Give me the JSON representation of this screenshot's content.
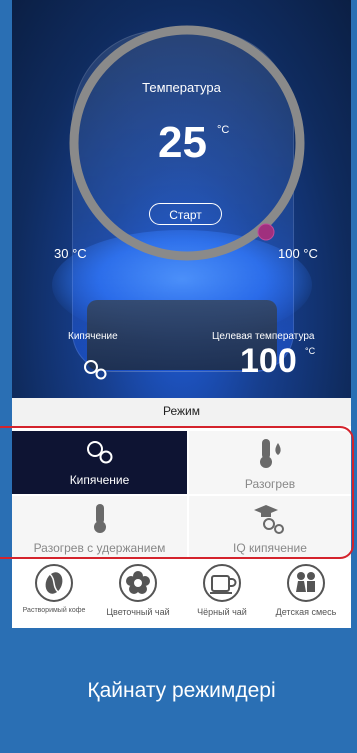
{
  "thermostat": {
    "title": "Температура",
    "current_value": "25",
    "unit": "°C",
    "start_label": "Старт",
    "min_label": "30 °C",
    "max_label": "100 °C",
    "boil_label": "Кипячение",
    "target_label": "Целевая температура",
    "target_value": "100",
    "target_unit": "°C"
  },
  "modes": {
    "title": "Режим",
    "items": [
      {
        "label": "Кипячение",
        "icon": "bubbles-icon",
        "active": true
      },
      {
        "label": "Разогрев",
        "icon": "thermometer-flame-icon",
        "active": false
      },
      {
        "label": "Разогрев с удержанием",
        "icon": "thermometer-icon",
        "active": false
      },
      {
        "label": "IQ кипячение",
        "icon": "graduation-bubbles-icon",
        "active": false
      }
    ]
  },
  "drinks": [
    {
      "label": "Растворимый кофе",
      "icon": "coffee-bean-icon"
    },
    {
      "label": "Цветочный чай",
      "icon": "flower-icon"
    },
    {
      "label": "Чёрный чай",
      "icon": "cup-icon"
    },
    {
      "label": "Детская смесь",
      "icon": "children-icon"
    }
  ],
  "caption": "Қайнату режимдері",
  "colors": {
    "accent_ring": "#8a8a8a",
    "knob": "#a0307e",
    "active_mode_bg": "#0e1433",
    "banner_bg": "#2a6fb4",
    "highlight": "#d4232c"
  }
}
